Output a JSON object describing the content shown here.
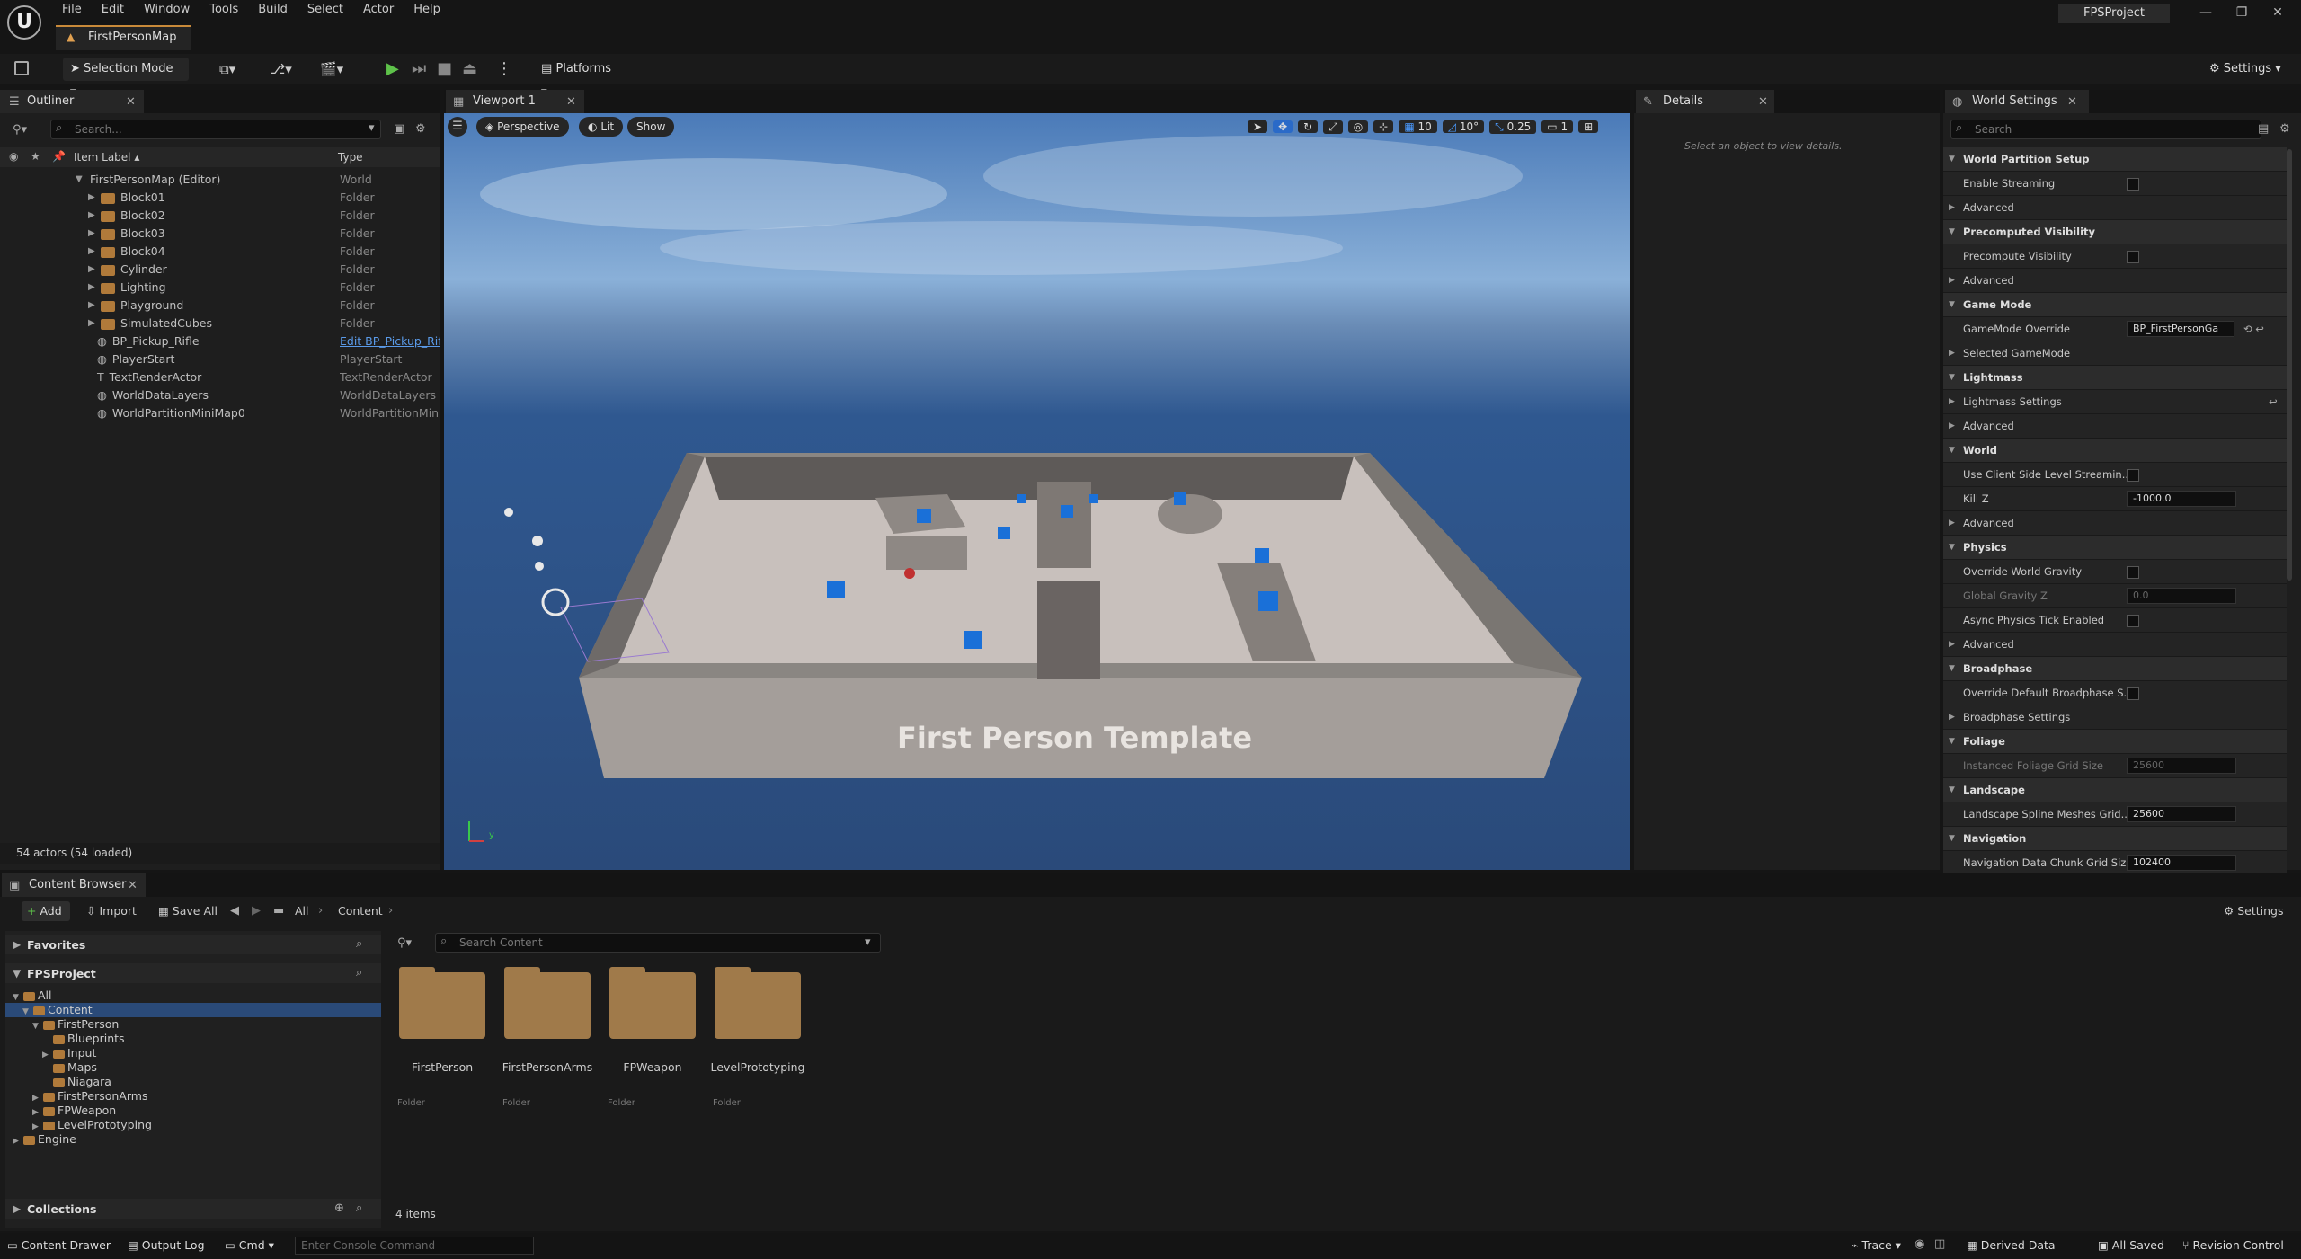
{
  "menu": [
    "File",
    "Edit",
    "Window",
    "Tools",
    "Build",
    "Select",
    "Actor",
    "Help"
  ],
  "project_name": "FPSProject",
  "map_tab": "FirstPersonMap",
  "toolbar": {
    "selection_mode": "Selection Mode",
    "platforms": "Platforms",
    "settings": "Settings"
  },
  "outliner": {
    "tab": "Outliner",
    "search_placeholder": "Search...",
    "col_label": "Item Label",
    "col_type": "Type",
    "rows": [
      {
        "label": "FirstPersonMap (Editor)",
        "type": "World"
      },
      {
        "label": "Block01",
        "type": "Folder"
      },
      {
        "label": "Block02",
        "type": "Folder"
      },
      {
        "label": "Block03",
        "type": "Folder"
      },
      {
        "label": "Block04",
        "type": "Folder"
      },
      {
        "label": "Cylinder",
        "type": "Folder"
      },
      {
        "label": "Lighting",
        "type": "Folder"
      },
      {
        "label": "Playground",
        "type": "Folder"
      },
      {
        "label": "SimulatedCubes",
        "type": "Folder"
      },
      {
        "label": "BP_Pickup_Rifle",
        "type": "Edit BP_Pickup_Rifl"
      },
      {
        "label": "PlayerStart",
        "type": "PlayerStart"
      },
      {
        "label": "TextRenderActor",
        "type": "TextRenderActor"
      },
      {
        "label": "WorldDataLayers",
        "type": "WorldDataLayers"
      },
      {
        "label": "WorldPartitionMiniMap0",
        "type": "WorldPartitionMini"
      }
    ],
    "status": "54 actors (54 loaded)"
  },
  "viewport": {
    "tab": "Viewport 1",
    "perspective": "Perspective",
    "lit": "Lit",
    "show": "Show",
    "grid": "10",
    "angle": "10°",
    "scale": "0.25",
    "cam": "1",
    "scene_text": "First Person Template"
  },
  "details": {
    "tab": "Details",
    "hint": "Select an object to view details."
  },
  "world_settings": {
    "tab": "World Settings",
    "search_placeholder": "Search",
    "rows": [
      {
        "kind": "cat",
        "label": "World Partition Setup"
      },
      {
        "kind": "chk",
        "label": "Enable Streaming"
      },
      {
        "kind": "adv",
        "label": "Advanced"
      },
      {
        "kind": "cat",
        "label": "Precomputed Visibility"
      },
      {
        "kind": "chk",
        "label": "Precompute Visibility"
      },
      {
        "kind": "adv",
        "label": "Advanced"
      },
      {
        "kind": "cat",
        "label": "Game Mode"
      },
      {
        "kind": "sel",
        "label": "GameMode Override",
        "value": "BP_FirstPersonGa"
      },
      {
        "kind": "adv",
        "label": "Selected GameMode"
      },
      {
        "kind": "cat",
        "label": "Lightmass"
      },
      {
        "kind": "adv",
        "label": "Lightmass Settings"
      },
      {
        "kind": "adv",
        "label": "Advanced"
      },
      {
        "kind": "cat",
        "label": "World"
      },
      {
        "kind": "chk",
        "label": "Use Client Side Level Streamin..."
      },
      {
        "kind": "val",
        "label": "Kill Z",
        "value": "-1000.0"
      },
      {
        "kind": "adv",
        "label": "Advanced"
      },
      {
        "kind": "cat",
        "label": "Physics"
      },
      {
        "kind": "chk",
        "label": "Override World Gravity"
      },
      {
        "kind": "valdim",
        "label": "Global Gravity Z",
        "value": "0.0"
      },
      {
        "kind": "chk",
        "label": "Async Physics Tick Enabled"
      },
      {
        "kind": "adv",
        "label": "Advanced"
      },
      {
        "kind": "cat",
        "label": "Broadphase"
      },
      {
        "kind": "chk",
        "label": "Override Default Broadphase S..."
      },
      {
        "kind": "adv",
        "label": "Broadphase Settings"
      },
      {
        "kind": "cat",
        "label": "Foliage"
      },
      {
        "kind": "valdim",
        "label": "Instanced Foliage Grid Size",
        "value": "25600"
      },
      {
        "kind": "cat",
        "label": "Landscape"
      },
      {
        "kind": "val",
        "label": "Landscape Spline Meshes Grid...",
        "value": "25600"
      },
      {
        "kind": "cat",
        "label": "Navigation"
      },
      {
        "kind": "val",
        "label": "Navigation Data Chunk Grid Size",
        "value": "102400"
      }
    ]
  },
  "content_browser": {
    "tab": "Content Browser",
    "add": "Add",
    "import": "Import",
    "save_all": "Save All",
    "crumb_all": "All",
    "crumb_content": "Content",
    "settings": "Settings",
    "favorites": "Favorites",
    "project": "FPSProject",
    "search_placeholder": "Search Content",
    "tree": [
      "All",
      "Content",
      "FirstPerson",
      "Blueprints",
      "Input",
      "Maps",
      "Niagara",
      "FirstPersonArms",
      "FPWeapon",
      "LevelPrototyping",
      "Engine"
    ],
    "collections": "Collections",
    "items": [
      {
        "name": "FirstPerson",
        "type": "Folder"
      },
      {
        "name": "FirstPersonArms",
        "type": "Folder"
      },
      {
        "name": "FPWeapon",
        "type": "Folder"
      },
      {
        "name": "LevelPrototyping",
        "type": "Folder"
      }
    ],
    "count": "4 items"
  },
  "statusbar": {
    "content_drawer": "Content Drawer",
    "output_log": "Output Log",
    "cmd": "Cmd",
    "console_placeholder": "Enter Console Command",
    "trace": "Trace",
    "derived": "Derived Data",
    "saved": "All Saved",
    "revision": "Revision Control"
  }
}
